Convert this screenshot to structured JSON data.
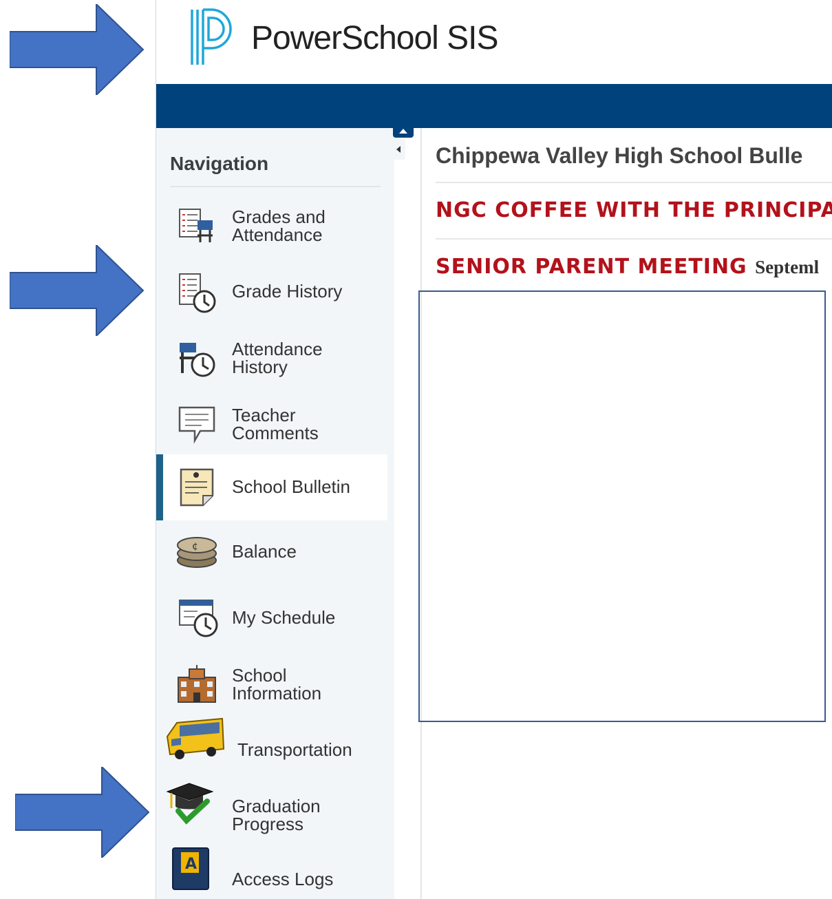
{
  "header": {
    "brand": "PowerSchool SIS"
  },
  "sidebar": {
    "heading": "Navigation",
    "items": [
      {
        "label": "Grades and\nAttendance",
        "active": false
      },
      {
        "label": "Grade History",
        "active": false
      },
      {
        "label": "Attendance\nHistory",
        "active": false
      },
      {
        "label": "Teacher\nComments",
        "active": false
      },
      {
        "label": "School Bulletin",
        "active": true
      },
      {
        "label": "Balance",
        "active": false
      },
      {
        "label": "My Schedule",
        "active": false
      },
      {
        "label": "School\nInformation",
        "active": false
      },
      {
        "label": "Transportation",
        "active": false
      },
      {
        "label": "Graduation\nProgress",
        "active": false
      },
      {
        "label": "Access Logs",
        "active": false
      }
    ]
  },
  "main": {
    "title": "Chippewa Valley High School Bulle",
    "bulletin_items": [
      {
        "title": "NGC COFFEE WITH THE PRINCIPA",
        "date": ""
      },
      {
        "title": "SENIOR PARENT MEETING",
        "date": "Septeml"
      }
    ]
  },
  "colors": {
    "brand_blue": "#00427c",
    "arrow_blue": "#4472c4",
    "bulletin_red": "#b3121b",
    "active_bar": "#1f6289"
  },
  "icons": [
    "grades-icon",
    "grade-history-icon",
    "attendance-history-icon",
    "comment-icon",
    "bulletin-icon",
    "coins-icon",
    "schedule-icon",
    "school-icon",
    "bus-icon",
    "graduation-cap-icon",
    "access-log-icon"
  ]
}
